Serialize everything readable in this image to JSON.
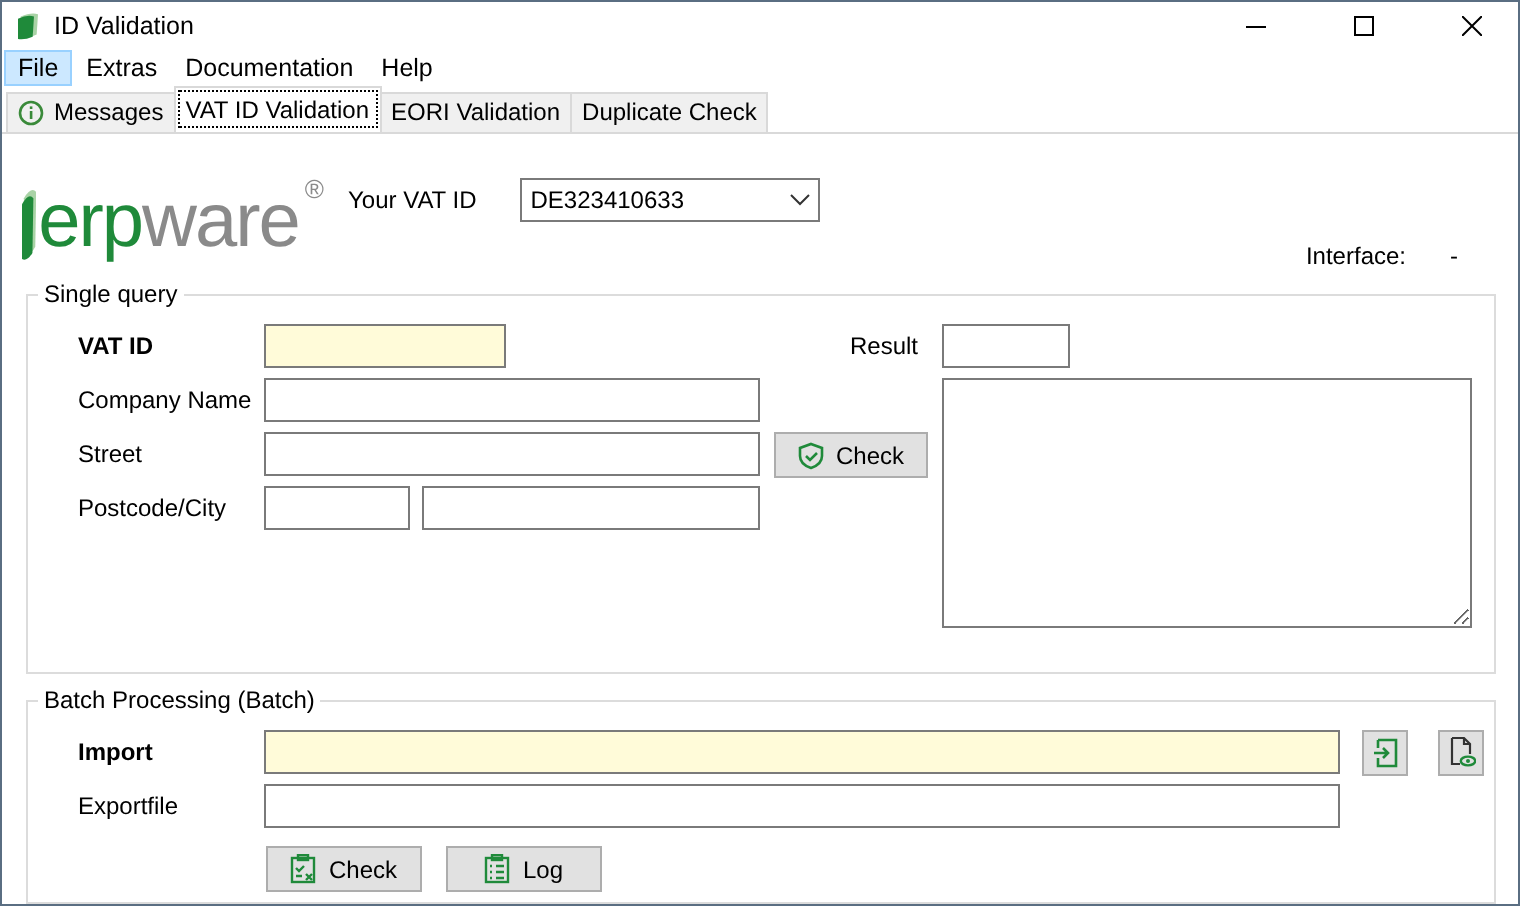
{
  "window": {
    "title": "ID Validation"
  },
  "menu": [
    {
      "label": "File",
      "selected": true
    },
    {
      "label": "Extras",
      "selected": false
    },
    {
      "label": "Documentation",
      "selected": false
    },
    {
      "label": "Help",
      "selected": false
    }
  ],
  "tabs": [
    {
      "label": "Messages",
      "selected": false,
      "kind": "info"
    },
    {
      "label": "VAT ID Validation",
      "selected": true,
      "kind": "plain"
    },
    {
      "label": "EORI Validation",
      "selected": false,
      "kind": "plain"
    },
    {
      "label": "Duplicate Check",
      "selected": false,
      "kind": "plain"
    }
  ],
  "logo": {
    "wordmark_parts": [
      "erp",
      "ware",
      "®"
    ]
  },
  "vat_selector": {
    "label": "Your VAT ID",
    "value": "DE323410633"
  },
  "interface": {
    "label": "Interface:",
    "value": "-"
  },
  "single_query": {
    "title": "Single query",
    "fields": [
      {
        "label": "VAT ID",
        "required": true,
        "kind": "single"
      },
      {
        "label": "Company Name",
        "required": false,
        "kind": "single"
      },
      {
        "label": "Street",
        "required": false,
        "kind": "single"
      },
      {
        "label": "Postcode/City",
        "required": false,
        "kind": "split"
      }
    ],
    "check_button": "Check",
    "result_label": "Result"
  },
  "batch": {
    "title": "Batch Processing (Batch)",
    "fields": [
      {
        "label": "Import",
        "required": true
      },
      {
        "label": "Exportfile",
        "required": false
      }
    ],
    "buttons": [
      {
        "label": "Check",
        "kind": "check"
      },
      {
        "label": "Log",
        "kind": "log"
      }
    ]
  }
}
